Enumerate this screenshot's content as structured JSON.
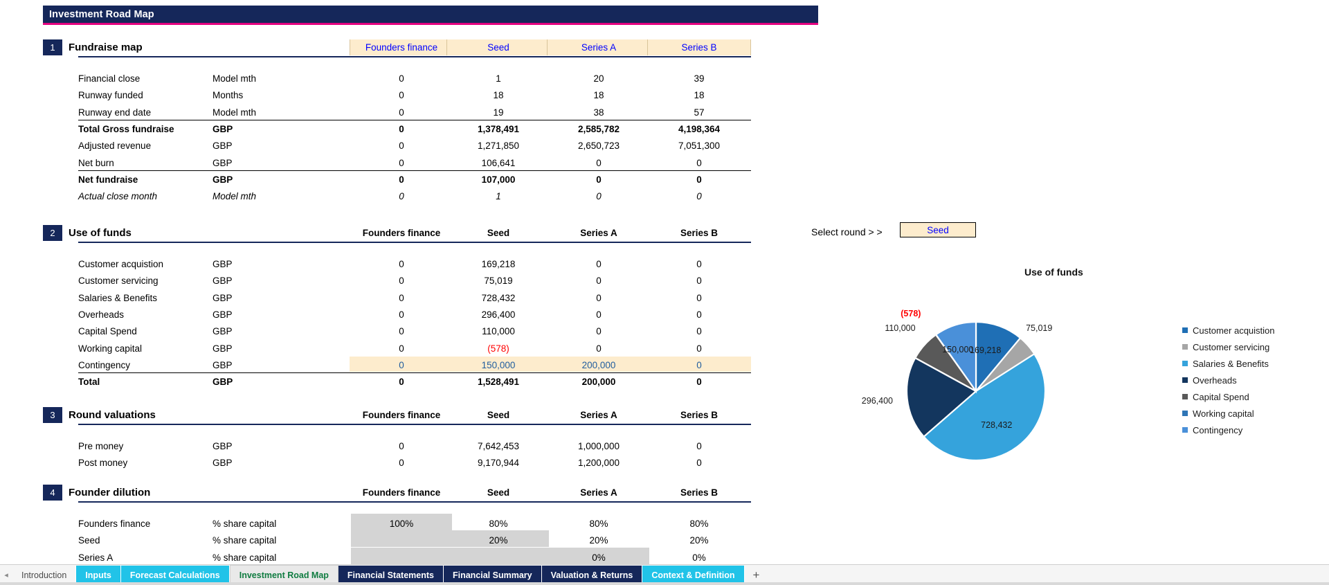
{
  "header": {
    "title": "Investment Road Map",
    "accent": "#e4007f",
    "navy": "#15275a"
  },
  "select_round": {
    "label": "Select round > >",
    "value": "Seed"
  },
  "columns": [
    "Founders finance",
    "Seed",
    "Series A",
    "Series B"
  ],
  "sections": [
    {
      "num": "1",
      "name": "Fundraise map",
      "header_style": "input",
      "rows": [
        {
          "label": "Financial close",
          "unit": "Model mth",
          "values": [
            "0",
            "1",
            "20",
            "39"
          ],
          "style": "normal"
        },
        {
          "label": "Runway funded",
          "unit": "Months",
          "values": [
            "0",
            "18",
            "18",
            "18"
          ],
          "style": "normal"
        },
        {
          "label": "Runway end date",
          "unit": "Model mth",
          "values": [
            "0",
            "19",
            "38",
            "57"
          ],
          "style": "normal"
        },
        {
          "label": "Total Gross fundraise",
          "unit": "GBP",
          "values": [
            "0",
            "1,378,491",
            "2,585,782",
            "4,198,364"
          ],
          "style": "bold",
          "rule_above": true
        },
        {
          "label": "Adjusted revenue",
          "unit": "GBP",
          "values": [
            "0",
            "1,271,850",
            "2,650,723",
            "7,051,300"
          ],
          "style": "normal"
        },
        {
          "label": "Net burn",
          "unit": "GBP",
          "values": [
            "0",
            "106,641",
            "0",
            "0"
          ],
          "style": "normal"
        },
        {
          "label": "Net fundraise",
          "unit": "GBP",
          "values": [
            "0",
            "107,000",
            "0",
            "0"
          ],
          "style": "bold",
          "rule_above": true
        },
        {
          "label": "Actual close month",
          "unit": "Model mth",
          "values": [
            "0",
            "1",
            "0",
            "0"
          ],
          "style": "italic"
        }
      ]
    },
    {
      "num": "2",
      "name": "Use of funds",
      "header_style": "plain",
      "rows": [
        {
          "label": "Customer acquistion",
          "unit": "GBP",
          "values": [
            "0",
            "169,218",
            "0",
            "0"
          ],
          "style": "normal"
        },
        {
          "label": "Customer servicing",
          "unit": "GBP",
          "values": [
            "0",
            "75,019",
            "0",
            "0"
          ],
          "style": "normal"
        },
        {
          "label": "Salaries & Benefits",
          "unit": "GBP",
          "values": [
            "0",
            "728,432",
            "0",
            "0"
          ],
          "style": "normal"
        },
        {
          "label": "Overheads",
          "unit": "GBP",
          "values": [
            "0",
            "296,400",
            "0",
            "0"
          ],
          "style": "normal"
        },
        {
          "label": "Capital Spend",
          "unit": "GBP",
          "values": [
            "0",
            "110,000",
            "0",
            "0"
          ],
          "style": "normal"
        },
        {
          "label": "Working capital",
          "unit": "GBP",
          "values": [
            "0",
            "(578)",
            "0",
            "0"
          ],
          "style": "normal",
          "value_colors": [
            "",
            "red",
            "",
            ""
          ]
        },
        {
          "label": "Contingency",
          "unit": "GBP",
          "values": [
            "0",
            "150,000",
            "200,000",
            "0"
          ],
          "style": "input"
        },
        {
          "label": "Total",
          "unit": "GBP",
          "values": [
            "0",
            "1,528,491",
            "200,000",
            "0"
          ],
          "style": "bold",
          "rule_above": true
        }
      ]
    },
    {
      "num": "3",
      "name": "Round valuations",
      "header_style": "plain",
      "rows": [
        {
          "label": "Pre money",
          "unit": "GBP",
          "values": [
            "0",
            "7,642,453",
            "1,000,000",
            "0"
          ],
          "style": "normal"
        },
        {
          "label": "Post money",
          "unit": "GBP",
          "values": [
            "0",
            "9,170,944",
            "1,200,000",
            "0"
          ],
          "style": "normal"
        }
      ]
    },
    {
      "num": "4",
      "name": "Founder dilution",
      "header_style": "plain",
      "rows": [
        {
          "label": "Founders finance",
          "unit": "% share capital",
          "values": [
            "100%",
            "80%",
            "80%",
            "80%"
          ],
          "style": "normal",
          "blocked": [
            0
          ]
        },
        {
          "label": "Seed",
          "unit": "% share capital",
          "values": [
            "",
            "20%",
            "20%",
            "20%"
          ],
          "style": "normal",
          "blocked": [
            0,
            1
          ]
        },
        {
          "label": "Series A",
          "unit": "% share capital",
          "values": [
            "",
            "",
            "0%",
            "0%"
          ],
          "style": "normal",
          "blocked": [
            0,
            1,
            2
          ]
        }
      ]
    }
  ],
  "chart_data": {
    "type": "pie",
    "title": "Use of funds",
    "categories": [
      "Customer acquistion",
      "Customer servicing",
      "Salaries & Benefits",
      "Overheads",
      "Capital Spend",
      "Working capital",
      "Contingency"
    ],
    "values": [
      169218,
      75019,
      728432,
      296400,
      110000,
      -578,
      150000
    ],
    "labels": [
      "169,218",
      "75,019",
      "728,432",
      "296,400",
      "110,000",
      "(578)",
      "150,000"
    ],
    "colors": [
      "#1f6fb5",
      "#a6a6a6",
      "#35a3dc",
      "#13365e",
      "#595959",
      "#2e75b6",
      "#4a90d9"
    ],
    "legend_position": "right",
    "grid": false
  },
  "tabs": [
    {
      "label": "Introduction",
      "style": "plain"
    },
    {
      "label": "Inputs",
      "style": "cyan"
    },
    {
      "label": "Forecast Calculations",
      "style": "cyan"
    },
    {
      "label": "Investment Road Map",
      "style": "active"
    },
    {
      "label": "Financial Statements",
      "style": "navy"
    },
    {
      "label": "Financial Summary",
      "style": "navy"
    },
    {
      "label": "Valuation & Returns",
      "style": "navy"
    },
    {
      "label": "Context & Definition",
      "style": "cyan"
    }
  ],
  "tab_add_label": "+",
  "tab_scroll_label": "◂"
}
